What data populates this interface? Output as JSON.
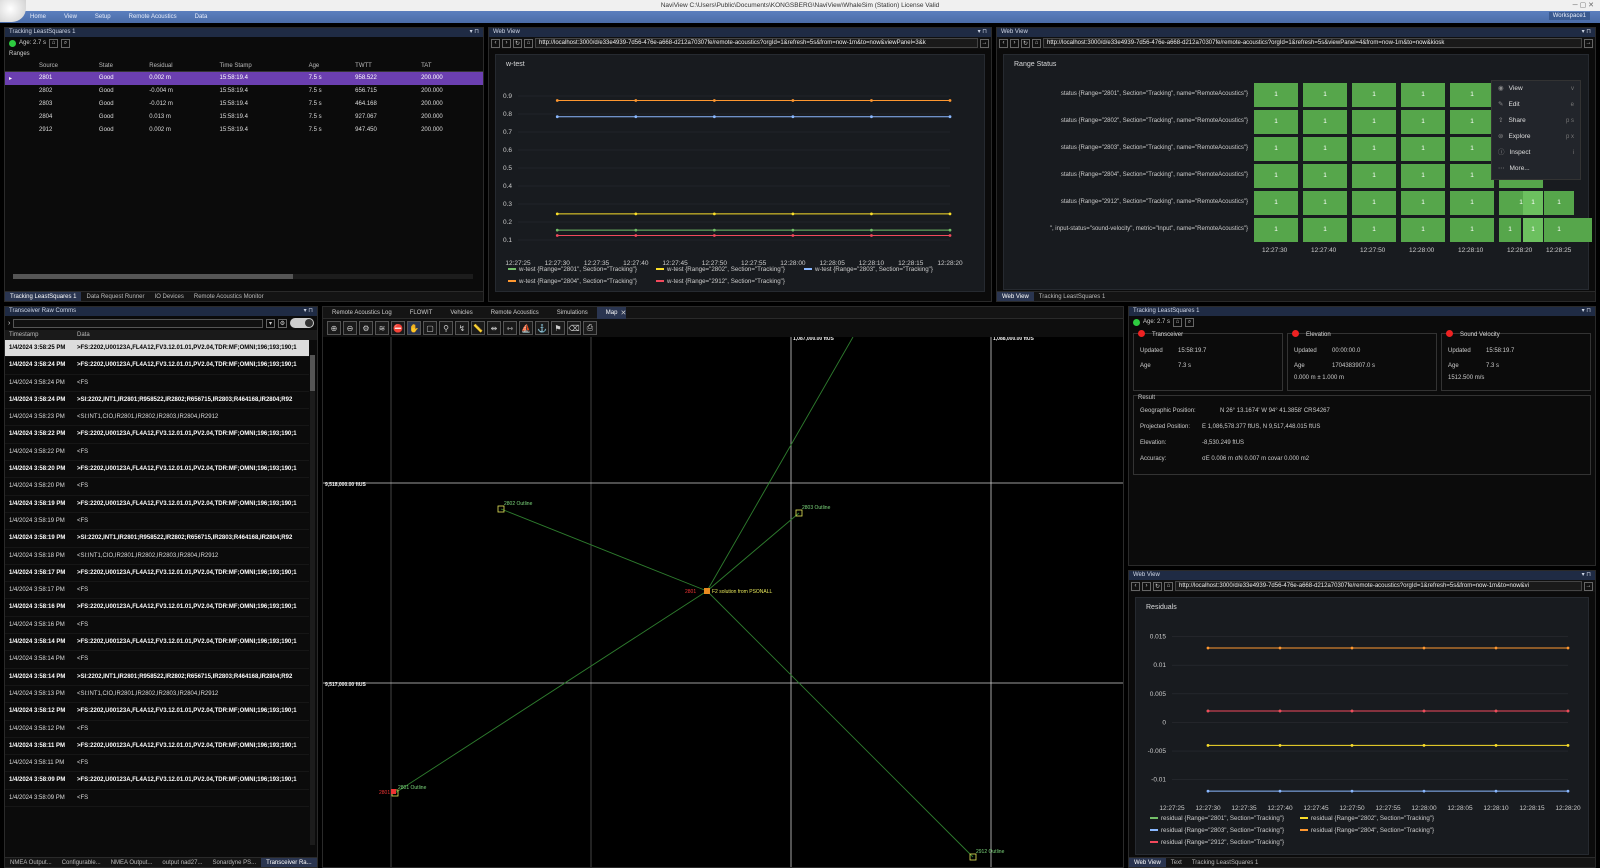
{
  "window": {
    "title": "NaviView C:\\Users\\Public\\Documents\\KONGSBERG\\NaviView\\WhaleSim (Station)  License Valid",
    "workspace": "Workspace1"
  },
  "menu": [
    "Home",
    "View",
    "Setup",
    "Remote Acoustics",
    "Data"
  ],
  "tracking": {
    "title": "Tracking LeastSquares 1",
    "age": "Age: 2.7 s",
    "section": "Ranges",
    "columns": [
      "Source",
      "State",
      "Residual",
      "Time Stamp",
      "Age",
      "TWTT",
      "TAT"
    ],
    "rows": [
      [
        "2801",
        "Good",
        "0.002 m",
        "15:58:19.4",
        "7.5 s",
        "958.522",
        "200.000"
      ],
      [
        "2802",
        "Good",
        "-0.004 m",
        "15:58:19.4",
        "7.5 s",
        "656.715",
        "200.000"
      ],
      [
        "2803",
        "Good",
        "-0.012 m",
        "15:58:19.4",
        "7.5 s",
        "464.168",
        "200.000"
      ],
      [
        "2804",
        "Good",
        "0.013 m",
        "15:58:19.4",
        "7.5 s",
        "927.067",
        "200.000"
      ],
      [
        "2912",
        "Good",
        "0.002 m",
        "15:58:19.4",
        "7.5 s",
        "947.450",
        "200.000"
      ]
    ],
    "tabs": [
      "Tracking LeastSquares 1",
      "Data Request Runner",
      "IO Devices",
      "Remote Acoustics Monitor"
    ]
  },
  "web1": {
    "header": "Web View",
    "url": "http://localhost:3000/d/e33e4939-7d56-476e-a668-d212a70307fe/remote-acoustics?orgId=1&refresh=5s&from=now-1m&to=now&viewPanel=3&k",
    "chart_data": {
      "type": "line",
      "title": "w-test",
      "x": [
        "12:27:25",
        "12:27:30",
        "12:27:35",
        "12:27:40",
        "12:27:45",
        "12:27:50",
        "12:27:55",
        "12:28:00",
        "12:28:05",
        "12:28:10",
        "12:28:15",
        "12:28:20"
      ],
      "ylim": [
        0.05,
        0.95
      ],
      "yticks": [
        "0.9",
        "0.8",
        "0.7",
        "0.6",
        "0.5",
        "0.4",
        "0.3",
        "0.2",
        "0.1"
      ],
      "series": [
        {
          "name": "w-test {Range=\"2801\", Section=\"Tracking\"}",
          "color": "#73bf69",
          "value": 0.155
        },
        {
          "name": "w-test {Range=\"2802\", Section=\"Tracking\"}",
          "color": "#fade2a",
          "value": 0.245
        },
        {
          "name": "w-test {Range=\"2803\", Section=\"Tracking\"}",
          "color": "#8ab8ff",
          "value": 0.785
        },
        {
          "name": "w-test {Range=\"2804\", Section=\"Tracking\"}",
          "color": "#ff9830",
          "value": 0.875
        },
        {
          "name": "w-test {Range=\"2912\", Section=\"Tracking\"}",
          "color": "#f2495c",
          "value": 0.125
        }
      ]
    }
  },
  "web2": {
    "header": "Web View",
    "url": "http://localhost:3000/d/e33e4939-7d56-476e-a668-d212a70307fe/remote-acoustics?orgId=1&refresh=5s&viewPanel=4&from=now-1m&to=now&kiosk",
    "title": "Range Status",
    "rows": [
      "status {Range=\"2801\", Section=\"Tracking\", name=\"RemoteAcoustics\"}",
      "status {Range=\"2802\", Section=\"Tracking\", name=\"RemoteAcoustics\"}",
      "status {Range=\"2803\", Section=\"Tracking\", name=\"RemoteAcoustics\"}",
      "status {Range=\"2804\", Section=\"Tracking\", name=\"RemoteAcoustics\"}",
      "status {Range=\"2912\", Section=\"Tracking\", name=\"RemoteAcoustics\"}",
      "\", input-status=\"sound-velocity\", metric=\"Input\", name=\"RemoteAcoustics\"}"
    ],
    "cell_value": "1",
    "times": [
      "12:27:30",
      "12:27:40",
      "12:27:50",
      "12:28:00",
      "12:28:10",
      "12:28:20",
      "12:28:25"
    ],
    "menu": [
      {
        "label": "View",
        "sc": "v"
      },
      {
        "label": "Edit",
        "sc": "e"
      },
      {
        "label": "Share",
        "sc": "p s"
      },
      {
        "label": "Explore",
        "sc": "p x"
      },
      {
        "label": "Inspect",
        "sc": "i"
      },
      {
        "label": "More...",
        "sc": ""
      }
    ],
    "tabs": [
      "Web View",
      "Tracking LeastSquares 1"
    ]
  },
  "raw": {
    "title": "Transceiver Raw Comms",
    "columns": [
      "Timestamp",
      "Data"
    ],
    "rows": [
      {
        "t": "1/4/2024 3:58:25 PM",
        "d": ">FS:2202,U00123A,FL4A12,FV3.12.01.01,PV2.04,TDR:MF;OMNI;196;193;190;1",
        "b": true
      },
      {
        "t": "1/4/2024 3:58:24 PM",
        "d": ">FS:2202,U00123A,FL4A12,FV3.12.01.01,PV2.04,TDR:MF;OMNI;196;193;190;1",
        "b": true
      },
      {
        "t": "1/4/2024 3:58:24 PM",
        "d": "<FS",
        "b": false
      },
      {
        "t": "1/4/2024 3:58:24 PM",
        "d": ">SI:2202,INT1,IR2801;R958522,IR2802;R656715,IR2803;R464168,IR2804;R92",
        "b": true
      },
      {
        "t": "1/4/2024 3:58:23 PM",
        "d": "<SI:INT1,CIO,IR2801,IR2802,IR2803,IR2804,IR2912",
        "b": false
      },
      {
        "t": "1/4/2024 3:58:22 PM",
        "d": ">FS:2202,U00123A,FL4A12,FV3.12.01.01,PV2.04,TDR:MF;OMNI;196;193;190;1",
        "b": true
      },
      {
        "t": "1/4/2024 3:58:22 PM",
        "d": "<FS",
        "b": false
      },
      {
        "t": "1/4/2024 3:58:20 PM",
        "d": ">FS:2202,U00123A,FL4A12,FV3.12.01.01,PV2.04,TDR:MF;OMNI;196;193;190;1",
        "b": true
      },
      {
        "t": "1/4/2024 3:58:20 PM",
        "d": "<FS",
        "b": false
      },
      {
        "t": "1/4/2024 3:58:19 PM",
        "d": ">FS:2202,U00123A,FL4A12,FV3.12.01.01,PV2.04,TDR:MF;OMNI;196;193;190;1",
        "b": true
      },
      {
        "t": "1/4/2024 3:58:19 PM",
        "d": "<FS",
        "b": false
      },
      {
        "t": "1/4/2024 3:58:19 PM",
        "d": ">SI:2202,INT1,IR2801;R958522,IR2802;R656715,IR2803;R464168,IR2804;R92",
        "b": true
      },
      {
        "t": "1/4/2024 3:58:18 PM",
        "d": "<SI:INT1,CIO,IR2801,IR2802,IR2803,IR2804,IR2912",
        "b": false
      },
      {
        "t": "1/4/2024 3:58:17 PM",
        "d": ">FS:2202,U00123A,FL4A12,FV3.12.01.01,PV2.04,TDR:MF;OMNI;196;193;190;1",
        "b": true
      },
      {
        "t": "1/4/2024 3:58:17 PM",
        "d": "<FS",
        "b": false
      },
      {
        "t": "1/4/2024 3:58:16 PM",
        "d": ">FS:2202,U00123A,FL4A12,FV3.12.01.01,PV2.04,TDR:MF;OMNI;196;193;190;1",
        "b": true
      },
      {
        "t": "1/4/2024 3:58:16 PM",
        "d": "<FS",
        "b": false
      },
      {
        "t": "1/4/2024 3:58:14 PM",
        "d": ">FS:2202,U00123A,FL4A12,FV3.12.01.01,PV2.04,TDR:MF;OMNI;196;193;190;1",
        "b": true
      },
      {
        "t": "1/4/2024 3:58:14 PM",
        "d": "<FS",
        "b": false
      },
      {
        "t": "1/4/2024 3:58:14 PM",
        "d": ">SI:2202,INT1,IR2801;R958522,IR2802;R656715,IR2803;R464168,IR2804;R92",
        "b": true
      },
      {
        "t": "1/4/2024 3:58:13 PM",
        "d": "<SI:INT1,CIO,IR2801,IR2802,IR2803,IR2804,IR2912",
        "b": false
      },
      {
        "t": "1/4/2024 3:58:12 PM",
        "d": ">FS:2202,U00123A,FL4A12,FV3.12.01.01,PV2.04,TDR:MF;OMNI;196;193;190;1",
        "b": true
      },
      {
        "t": "1/4/2024 3:58:12 PM",
        "d": "<FS",
        "b": false
      },
      {
        "t": "1/4/2024 3:58:11 PM",
        "d": ">FS:2202,U00123A,FL4A12,FV3.12.01.01,PV2.04,TDR:MF;OMNI;196;193;190;1",
        "b": true
      },
      {
        "t": "1/4/2024 3:58:11 PM",
        "d": "<FS",
        "b": false
      },
      {
        "t": "1/4/2024 3:58:09 PM",
        "d": ">FS:2202,U00123A,FL4A12,FV3.12.01.01,PV2.04,TDR:MF;OMNI;196;193;190;1",
        "b": true
      },
      {
        "t": "1/4/2024 3:58:09 PM",
        "d": "<FS",
        "b": false
      }
    ],
    "tabs": [
      "NMEA Output...",
      "Configurable...",
      "NMEA Output...",
      "output nad27...",
      "Sonardyne PS...",
      "Transceiver Ra..."
    ]
  },
  "map": {
    "tabs": [
      "Remote Acoustics Log",
      "FLOWIT",
      "Vehicles",
      "Remote Acoustics",
      "Simulations",
      "Map"
    ],
    "grid_labels": {
      "e1": "1,087,000.00 ftUS",
      "e2": "1,088,000.00 ftUS",
      "n1": "9,518,000.00 ftUS",
      "n2": "9,517,000.00 ftUS"
    },
    "labels": {
      "o2802": "2802 Outline",
      "o2803": "2803 Outline",
      "o2801": "2801 Outline",
      "o2912": "2912 Outline",
      "center": "F2 solution from PSONALL",
      "c1": "2801",
      "c2": "2801"
    }
  },
  "tls": {
    "title": "Tracking LeastSquares 1",
    "age": "Age: 2.7 s",
    "sections": [
      {
        "name": "Transceiver",
        "updated_k": "Updated",
        "updated_v": "15:58:19.7",
        "age_k": "Age",
        "age_v": "7.3 s",
        "extra": ""
      },
      {
        "name": "Elevation",
        "updated_k": "Updated",
        "updated_v": "00:00:00.0",
        "age_k": "Age",
        "age_v": "1704383907.0 s",
        "extra": "0.000 m ± 1.000 m"
      },
      {
        "name": "Sound Velocity",
        "updated_k": "Updated",
        "updated_v": "15:58:19.7",
        "age_k": "Age",
        "age_v": "7.3 s",
        "extra": "1512.500 m/s"
      }
    ],
    "result_title": "Result",
    "result": [
      {
        "k": "Geographic Position:",
        "v": "N 26° 13.1674' W 94° 41.3858' CRS4267"
      },
      {
        "k": "Projected Position:",
        "v": "E 1,086,578.377 ftUS, N 9,517,448.015 ftUS"
      },
      {
        "k": "Elevation:",
        "v": "-8,530.249 ftUS"
      },
      {
        "k": "Accuracy:",
        "v": "σE 0.006 m σN 0.007 m covar 0.000 m2"
      }
    ]
  },
  "web3": {
    "header": "Web View",
    "url": "http://localhost:3000/d/e33e4939-7d56-476e-a668-d212a70307fe/remote-acoustics?orgId=1&refresh=5s&from=now-1m&to=now&vi",
    "chart_data": {
      "type": "line",
      "title": "Residuals",
      "x": [
        "12:27:25",
        "12:27:30",
        "12:27:35",
        "12:27:40",
        "12:27:45",
        "12:27:50",
        "12:27:55",
        "12:28:00",
        "12:28:05",
        "12:28:10",
        "12:28:15",
        "12:28:20"
      ],
      "ylim": [
        -0.0125,
        0.0165
      ],
      "yticks": [
        "0.015",
        "0.01",
        "0.005",
        "0",
        "-0.005",
        "-0.01"
      ],
      "series": [
        {
          "name": "residual {Range=\"2801\", Section=\"Tracking\"}",
          "color": "#73bf69",
          "value": 0.002
        },
        {
          "name": "residual {Range=\"2802\", Section=\"Tracking\"}",
          "color": "#fade2a",
          "value": -0.004
        },
        {
          "name": "residual {Range=\"2803\", Section=\"Tracking\"}",
          "color": "#8ab8ff",
          "value": -0.012
        },
        {
          "name": "residual {Range=\"2804\", Section=\"Tracking\"}",
          "color": "#ff9830",
          "value": 0.013
        },
        {
          "name": "residual {Range=\"2912\", Section=\"Tracking\"}",
          "color": "#f2495c",
          "value": 0.002
        }
      ]
    },
    "tabs": [
      "Web View",
      "Text",
      "Tracking LeastSquares 1"
    ]
  }
}
